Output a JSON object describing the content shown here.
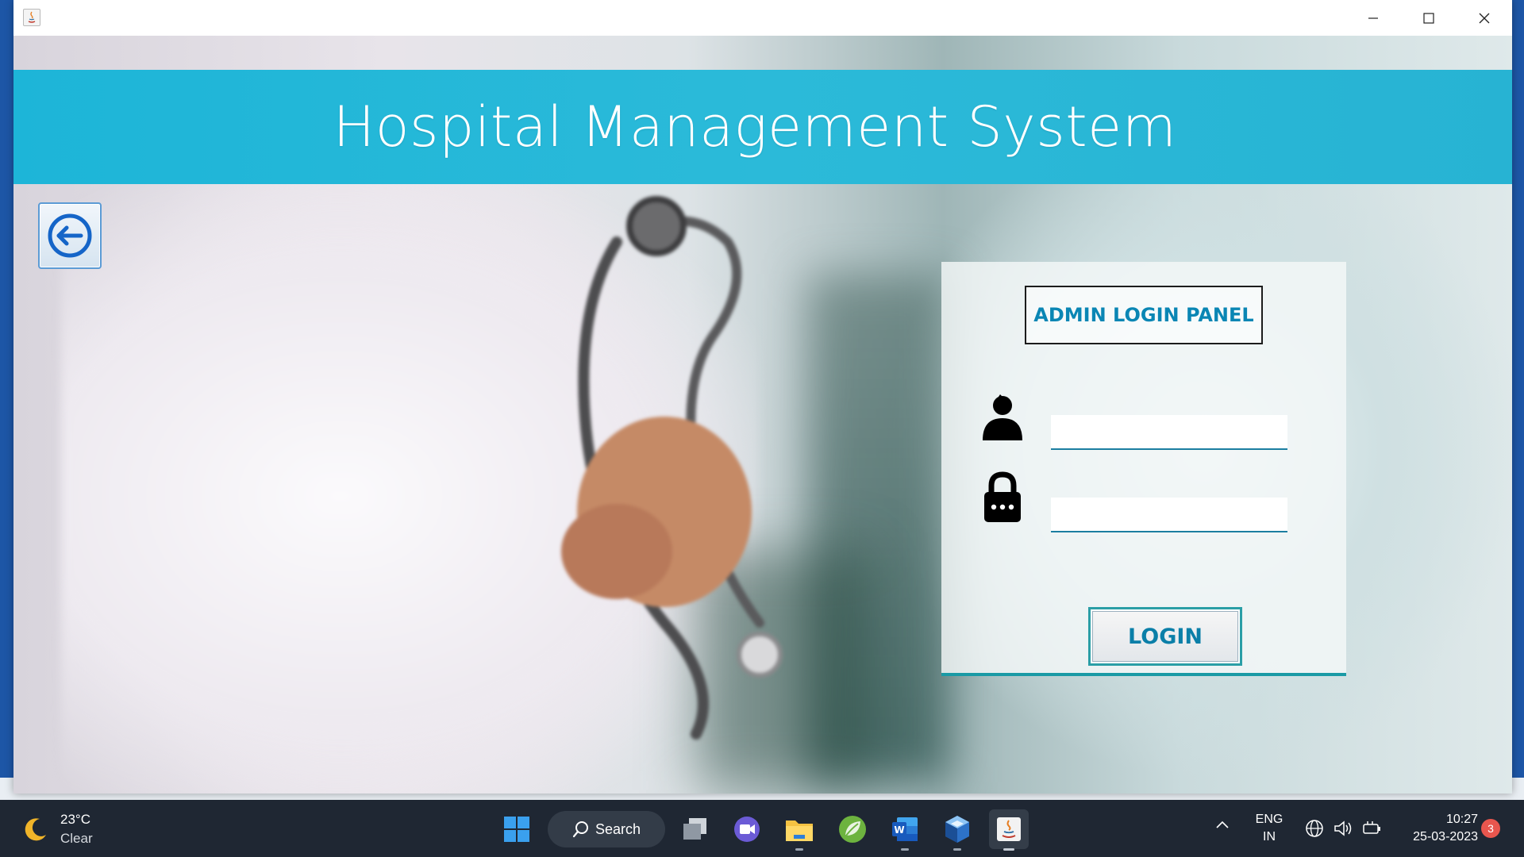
{
  "window": {
    "title": "",
    "controls": {
      "minimize": "minimize",
      "maximize": "maximize",
      "close": "close"
    }
  },
  "header": {
    "title": "Hospital Management System"
  },
  "back_button": {
    "icon": "back-arrow-icon"
  },
  "login_panel": {
    "heading": "ADMIN LOGIN PANEL",
    "username": {
      "icon": "user-icon",
      "value": "",
      "placeholder": ""
    },
    "password": {
      "icon": "lock-icon",
      "value": "",
      "placeholder": ""
    },
    "login_button": "LOGIN"
  },
  "taskbar": {
    "weather": {
      "temperature": "23°C",
      "condition": "Clear",
      "icon": "moon-icon"
    },
    "search_label": "Search",
    "apps": [
      {
        "name": "start",
        "icon": "windows-logo-icon"
      },
      {
        "name": "task-view",
        "icon": "task-view-icon"
      },
      {
        "name": "teams",
        "icon": "video-chat-icon"
      },
      {
        "name": "file-explorer",
        "icon": "folder-icon"
      },
      {
        "name": "spring-tool",
        "icon": "leaf-icon"
      },
      {
        "name": "word",
        "icon": "word-icon"
      },
      {
        "name": "virtualbox",
        "icon": "cube-icon"
      },
      {
        "name": "java",
        "icon": "java-icon"
      }
    ],
    "language": {
      "line1": "ENG",
      "line2": "IN"
    },
    "clock": {
      "time": "10:27",
      "date": "25-03-2023"
    },
    "notifications": "3"
  },
  "colors": {
    "header_band": "#27b4d6",
    "accent_teal": "#1a9aa5",
    "heading_text": "#0a86b4",
    "taskbar": "#1f2733"
  }
}
